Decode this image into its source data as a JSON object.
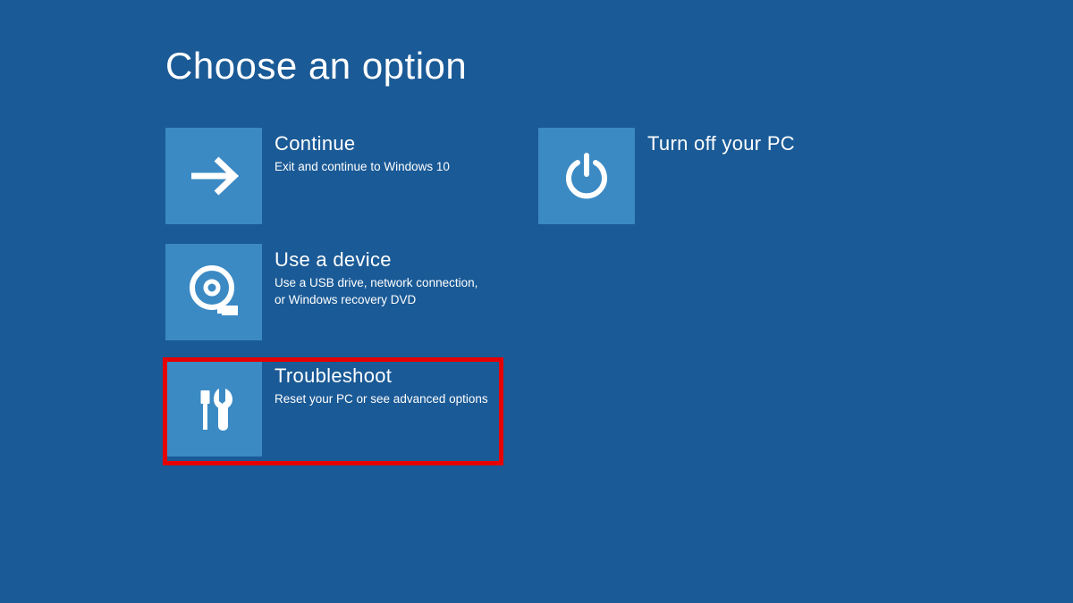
{
  "page": {
    "title": "Choose an option"
  },
  "options": {
    "continue": {
      "title": "Continue",
      "desc": "Exit and continue to Windows 10"
    },
    "useDevice": {
      "title": "Use a device",
      "desc": "Use a USB drive, network connection, or Windows recovery DVD"
    },
    "troubleshoot": {
      "title": "Troubleshoot",
      "desc": "Reset your PC or see advanced options"
    },
    "turnOff": {
      "title": "Turn off your PC",
      "desc": ""
    }
  }
}
